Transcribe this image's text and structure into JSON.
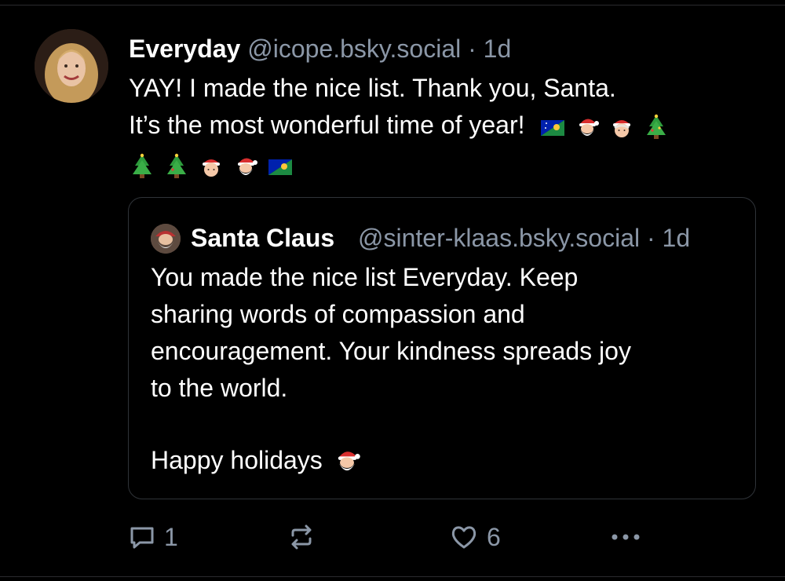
{
  "post": {
    "author_name": "Everyday",
    "author_handle": "@icope.bsky.social",
    "separator": "·",
    "time": "1d",
    "text_line1": "YAY! I made the nice list. Thank you, Santa.",
    "text_line2": "It’s the most wonderful time of year!",
    "emojis_line2": [
      "christmas-island-flag-icon",
      "santa-icon",
      "mrs-claus-icon",
      "christmas-tree-icon"
    ],
    "emojis_line3": [
      "christmas-tree-icon",
      "christmas-tree-icon",
      "mrs-claus-icon",
      "santa-icon",
      "christmas-island-flag-icon"
    ]
  },
  "quote": {
    "author_name": "Santa Claus",
    "author_handle": "@sinter-klaas.bsky.social",
    "separator": "·",
    "time": "1d",
    "text_lines": [
      "You made the nice list Everyday. Keep",
      "sharing words of compassion and",
      "encouragement. Your kindness spreads joy",
      "to the world."
    ],
    "greeting": "Happy holidays"
  },
  "actions": {
    "reply_count": "1",
    "like_count": "6"
  },
  "colors": {
    "background": "#000000",
    "text": "#ffffff",
    "muted": "#8b97a7",
    "border": "#2f3338"
  }
}
